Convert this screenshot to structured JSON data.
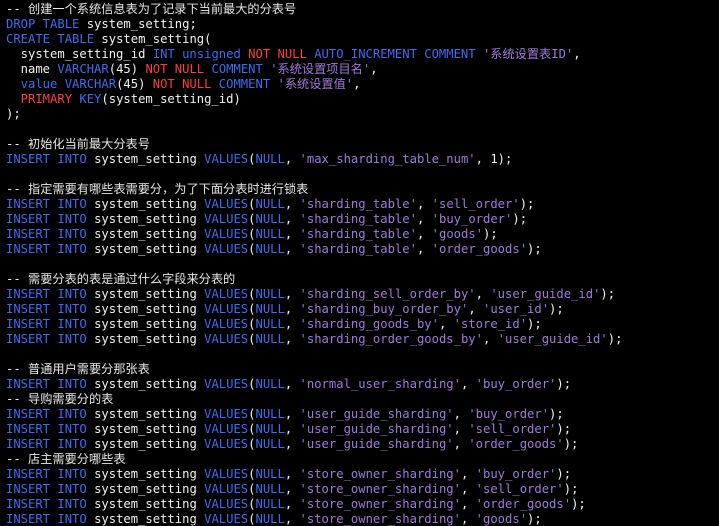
{
  "lines": [
    [
      [
        "cm",
        "-- 创建一个系统信息表为了记录下当前最大的分表号"
      ]
    ],
    [
      [
        "kw",
        "DROP TABLE "
      ],
      [
        "tx",
        "system_setting;"
      ]
    ],
    [
      [
        "kw",
        "CREATE TABLE "
      ],
      [
        "tx",
        "system_setting("
      ]
    ],
    [
      [
        "tx",
        "  system_setting_id "
      ],
      [
        "kw",
        "INT unsigned "
      ],
      [
        "kr",
        "NOT NULL "
      ],
      [
        "kw",
        "AUTO_INCREMENT COMMENT "
      ],
      [
        "st",
        "'系统设置表ID'"
      ],
      [
        "tx",
        ","
      ]
    ],
    [
      [
        "tx",
        "  name "
      ],
      [
        "kw",
        "VARCHAR"
      ],
      [
        "tx",
        "(45) "
      ],
      [
        "kr",
        "NOT NULL "
      ],
      [
        "kw",
        "COMMENT "
      ],
      [
        "st",
        "'系统设置项目名'"
      ],
      [
        "tx",
        ","
      ]
    ],
    [
      [
        "kw",
        "  value VARCHAR"
      ],
      [
        "tx",
        "(45) "
      ],
      [
        "kr",
        "NOT NULL "
      ],
      [
        "kw",
        "COMMENT "
      ],
      [
        "st",
        "'系统设置值'"
      ],
      [
        "tx",
        ","
      ]
    ],
    [
      [
        "kr",
        "  PRIMARY "
      ],
      [
        "kw",
        "KEY"
      ],
      [
        "tx",
        "(system_setting_id)"
      ]
    ],
    [
      [
        "tx",
        ");"
      ]
    ],
    [],
    [
      [
        "cm",
        "-- 初始化当前最大分表号"
      ]
    ],
    [
      [
        "kw",
        "INSERT INTO "
      ],
      [
        "tx",
        "system_setting "
      ],
      [
        "kw",
        "VALUES"
      ],
      [
        "tx",
        "("
      ],
      [
        "kw",
        "NULL"
      ],
      [
        "tx",
        ", "
      ],
      [
        "st",
        "'max_sharding_table_num'"
      ],
      [
        "tx",
        ", 1);"
      ]
    ],
    [],
    [
      [
        "cm",
        "-- 指定需要有哪些表需要分，为了下面分表时进行锁表"
      ]
    ],
    [
      [
        "kw",
        "INSERT INTO "
      ],
      [
        "tx",
        "system_setting "
      ],
      [
        "kw",
        "VALUES"
      ],
      [
        "tx",
        "("
      ],
      [
        "kw",
        "NULL"
      ],
      [
        "tx",
        ", "
      ],
      [
        "st",
        "'sharding_table'"
      ],
      [
        "tx",
        ", "
      ],
      [
        "st",
        "'sell_order'"
      ],
      [
        "tx",
        ");"
      ]
    ],
    [
      [
        "kw",
        "INSERT INTO "
      ],
      [
        "tx",
        "system_setting "
      ],
      [
        "kw",
        "VALUES"
      ],
      [
        "tx",
        "("
      ],
      [
        "kw",
        "NULL"
      ],
      [
        "tx",
        ", "
      ],
      [
        "st",
        "'sharding_table'"
      ],
      [
        "tx",
        ", "
      ],
      [
        "st",
        "'buy_order'"
      ],
      [
        "tx",
        ");"
      ]
    ],
    [
      [
        "kw",
        "INSERT INTO "
      ],
      [
        "tx",
        "system_setting "
      ],
      [
        "kw",
        "VALUES"
      ],
      [
        "tx",
        "("
      ],
      [
        "kw",
        "NULL"
      ],
      [
        "tx",
        ", "
      ],
      [
        "st",
        "'sharding_table'"
      ],
      [
        "tx",
        ", "
      ],
      [
        "st",
        "'goods'"
      ],
      [
        "tx",
        ");"
      ]
    ],
    [
      [
        "kw",
        "INSERT INTO "
      ],
      [
        "tx",
        "system_setting "
      ],
      [
        "kw",
        "VALUES"
      ],
      [
        "tx",
        "("
      ],
      [
        "kw",
        "NULL"
      ],
      [
        "tx",
        ", "
      ],
      [
        "st",
        "'sharding_table'"
      ],
      [
        "tx",
        ", "
      ],
      [
        "st",
        "'order_goods'"
      ],
      [
        "tx",
        ");"
      ]
    ],
    [],
    [
      [
        "cm",
        "-- 需要分表的表是通过什么字段来分表的"
      ]
    ],
    [
      [
        "kw",
        "INSERT INTO "
      ],
      [
        "tx",
        "system_setting "
      ],
      [
        "kw",
        "VALUES"
      ],
      [
        "tx",
        "("
      ],
      [
        "kw",
        "NULL"
      ],
      [
        "tx",
        ", "
      ],
      [
        "st",
        "'sharding_sell_order_by'"
      ],
      [
        "tx",
        ", "
      ],
      [
        "st",
        "'user_guide_id'"
      ],
      [
        "tx",
        ");"
      ]
    ],
    [
      [
        "kw",
        "INSERT INTO "
      ],
      [
        "tx",
        "system_setting "
      ],
      [
        "kw",
        "VALUES"
      ],
      [
        "tx",
        "("
      ],
      [
        "kw",
        "NULL"
      ],
      [
        "tx",
        ", "
      ],
      [
        "st",
        "'sharding_buy_order_by'"
      ],
      [
        "tx",
        ", "
      ],
      [
        "st",
        "'user_id'"
      ],
      [
        "tx",
        ");"
      ]
    ],
    [
      [
        "kw",
        "INSERT INTO "
      ],
      [
        "tx",
        "system_setting "
      ],
      [
        "kw",
        "VALUES"
      ],
      [
        "tx",
        "("
      ],
      [
        "kw",
        "NULL"
      ],
      [
        "tx",
        ", "
      ],
      [
        "st",
        "'sharding_goods_by'"
      ],
      [
        "tx",
        ", "
      ],
      [
        "st",
        "'store_id'"
      ],
      [
        "tx",
        ");"
      ]
    ],
    [
      [
        "kw",
        "INSERT INTO "
      ],
      [
        "tx",
        "system_setting "
      ],
      [
        "kw",
        "VALUES"
      ],
      [
        "tx",
        "("
      ],
      [
        "kw",
        "NULL"
      ],
      [
        "tx",
        ", "
      ],
      [
        "st",
        "'sharding_order_goods_by'"
      ],
      [
        "tx",
        ", "
      ],
      [
        "st",
        "'user_guide_id'"
      ],
      [
        "tx",
        ");"
      ]
    ],
    [],
    [
      [
        "cm",
        "-- 普通用户需要分那张表"
      ]
    ],
    [
      [
        "kw",
        "INSERT INTO "
      ],
      [
        "tx",
        "system_setting "
      ],
      [
        "kw",
        "VALUES"
      ],
      [
        "tx",
        "("
      ],
      [
        "kw",
        "NULL"
      ],
      [
        "tx",
        ", "
      ],
      [
        "st",
        "'normal_user_sharding'"
      ],
      [
        "tx",
        ", "
      ],
      [
        "st",
        "'buy_order'"
      ],
      [
        "tx",
        ");"
      ]
    ],
    [
      [
        "cm",
        "-- 导购需要分的表"
      ]
    ],
    [
      [
        "kw",
        "INSERT INTO "
      ],
      [
        "tx",
        "system_setting "
      ],
      [
        "kw",
        "VALUES"
      ],
      [
        "tx",
        "("
      ],
      [
        "kw",
        "NULL"
      ],
      [
        "tx",
        ", "
      ],
      [
        "st",
        "'user_guide_sharding'"
      ],
      [
        "tx",
        ", "
      ],
      [
        "st",
        "'buy_order'"
      ],
      [
        "tx",
        ");"
      ]
    ],
    [
      [
        "kw",
        "INSERT INTO "
      ],
      [
        "tx",
        "system_setting "
      ],
      [
        "kw",
        "VALUES"
      ],
      [
        "tx",
        "("
      ],
      [
        "kw",
        "NULL"
      ],
      [
        "tx",
        ", "
      ],
      [
        "st",
        "'user_guide_sharding'"
      ],
      [
        "tx",
        ", "
      ],
      [
        "st",
        "'sell_order'"
      ],
      [
        "tx",
        ");"
      ]
    ],
    [
      [
        "kw",
        "INSERT INTO "
      ],
      [
        "tx",
        "system_setting "
      ],
      [
        "kw",
        "VALUES"
      ],
      [
        "tx",
        "("
      ],
      [
        "kw",
        "NULL"
      ],
      [
        "tx",
        ", "
      ],
      [
        "st",
        "'user_guide_sharding'"
      ],
      [
        "tx",
        ", "
      ],
      [
        "st",
        "'order_goods'"
      ],
      [
        "tx",
        ");"
      ]
    ],
    [
      [
        "cm",
        "-- 店主需要分哪些表"
      ]
    ],
    [
      [
        "kw",
        "INSERT INTO "
      ],
      [
        "tx",
        "system_setting "
      ],
      [
        "kw",
        "VALUES"
      ],
      [
        "tx",
        "("
      ],
      [
        "kw",
        "NULL"
      ],
      [
        "tx",
        ", "
      ],
      [
        "st",
        "'store_owner_sharding'"
      ],
      [
        "tx",
        ", "
      ],
      [
        "st",
        "'buy_order'"
      ],
      [
        "tx",
        ");"
      ]
    ],
    [
      [
        "kw",
        "INSERT INTO "
      ],
      [
        "tx",
        "system_setting "
      ],
      [
        "kw",
        "VALUES"
      ],
      [
        "tx",
        "("
      ],
      [
        "kw",
        "NULL"
      ],
      [
        "tx",
        ", "
      ],
      [
        "st",
        "'store_owner_sharding'"
      ],
      [
        "tx",
        ", "
      ],
      [
        "st",
        "'sell_order'"
      ],
      [
        "tx",
        ");"
      ]
    ],
    [
      [
        "kw",
        "INSERT INTO "
      ],
      [
        "tx",
        "system_setting "
      ],
      [
        "kw",
        "VALUES"
      ],
      [
        "tx",
        "("
      ],
      [
        "kw",
        "NULL"
      ],
      [
        "tx",
        ", "
      ],
      [
        "st",
        "'store_owner_sharding'"
      ],
      [
        "tx",
        ", "
      ],
      [
        "st",
        "'order_goods'"
      ],
      [
        "tx",
        ");"
      ]
    ],
    [
      [
        "kw",
        "INSERT INTO "
      ],
      [
        "tx",
        "system_setting "
      ],
      [
        "kw",
        "VALUES"
      ],
      [
        "tx",
        "("
      ],
      [
        "kw",
        "NULL"
      ],
      [
        "tx",
        ", "
      ],
      [
        "st",
        "'store_owner_sharding'"
      ],
      [
        "tx",
        ", "
      ],
      [
        "st",
        "'goods'"
      ],
      [
        "tx",
        ");"
      ]
    ]
  ]
}
